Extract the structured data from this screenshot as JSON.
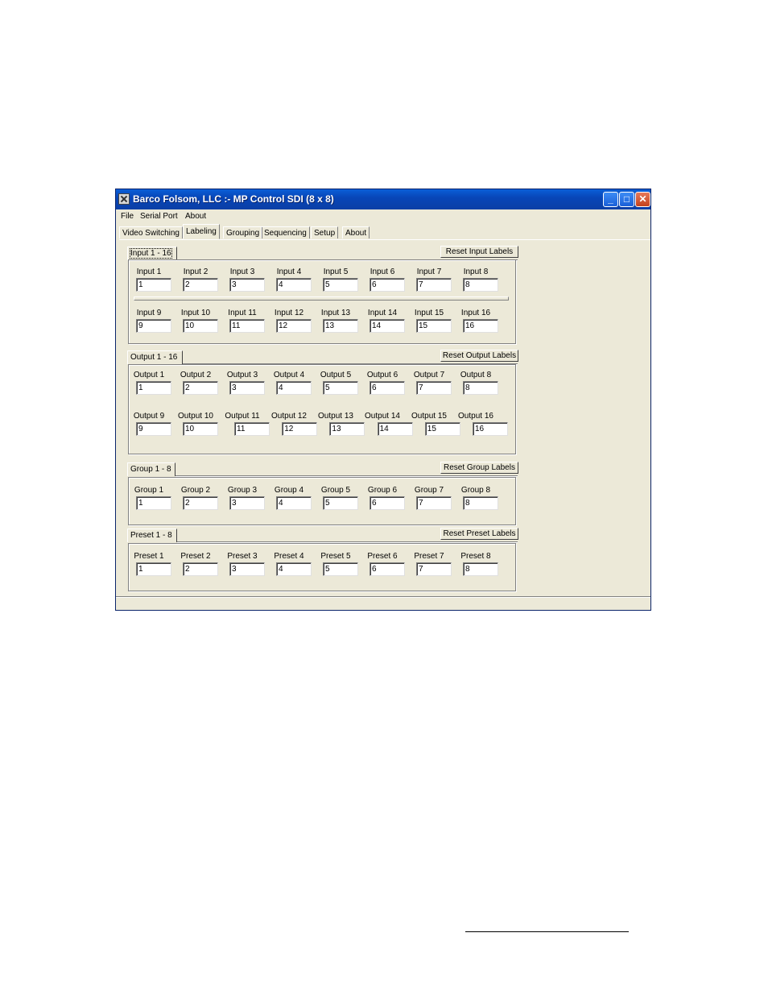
{
  "window": {
    "title": "Barco Folsom, LLC :- MP Control SDI (8 x 8)"
  },
  "menu": [
    "File",
    "Serial Port",
    "About"
  ],
  "tabs": [
    "Video Switching",
    "Labeling",
    "Grouping",
    "Sequencing",
    "Setup",
    "About"
  ],
  "active_tab": "Labeling",
  "sections": {
    "input": {
      "tab_label": "Input 1 - 16",
      "reset_label": "Reset Input Labels",
      "rows": [
        {
          "labels": [
            "Input 1",
            "Input 2",
            "Input 3",
            "Input 4",
            "Input 5",
            "Input 6",
            "Input 7",
            "Input 8"
          ],
          "values": [
            "1",
            "2",
            "3",
            "4",
            "5",
            "6",
            "7",
            "8"
          ]
        },
        {
          "labels": [
            "Input 9",
            "Input 10",
            "Input 11",
            "Input 12",
            "Input 13",
            "Input 14",
            "Input 15",
            "Input 16"
          ],
          "values": [
            "9",
            "10",
            "11",
            "12",
            "13",
            "14",
            "15",
            "16"
          ]
        }
      ]
    },
    "output": {
      "tab_label": "Output 1 - 16",
      "reset_label": "Reset Output Labels",
      "rows": [
        {
          "labels": [
            "Output 1",
            "Output 2",
            "Output 3",
            "Output 4",
            "Output 5",
            "Output 6",
            "Output 7",
            "Output 8"
          ],
          "values": [
            "1",
            "2",
            "3",
            "4",
            "5",
            "6",
            "7",
            "8"
          ]
        },
        {
          "labels": [
            "Output 9",
            "Output 10",
            "Output 11",
            "Output 12",
            "Output 13",
            "Output 14",
            "Output 15",
            "Output 16"
          ],
          "values": [
            "9",
            "10",
            "11",
            "12",
            "13",
            "14",
            "15",
            "16"
          ]
        }
      ]
    },
    "group": {
      "tab_label": "Group 1 - 8",
      "reset_label": "Reset Group Labels",
      "rows": [
        {
          "labels": [
            "Group 1",
            "Group 2",
            "Group 3",
            "Group 4",
            "Group 5",
            "Group 6",
            "Group 7",
            "Group 8"
          ],
          "values": [
            "1",
            "2",
            "3",
            "4",
            "5",
            "6",
            "7",
            "8"
          ]
        }
      ]
    },
    "preset": {
      "tab_label": "Preset 1 - 8",
      "reset_label": "Reset Preset Labels",
      "rows": [
        {
          "labels": [
            "Preset 1",
            "Preset 2",
            "Preset 3",
            "Preset 4",
            "Preset 5",
            "Preset 6",
            "Preset 7",
            "Preset 8"
          ],
          "values": [
            "1",
            "2",
            "3",
            "4",
            "5",
            "6",
            "7",
            "8"
          ]
        }
      ]
    }
  }
}
